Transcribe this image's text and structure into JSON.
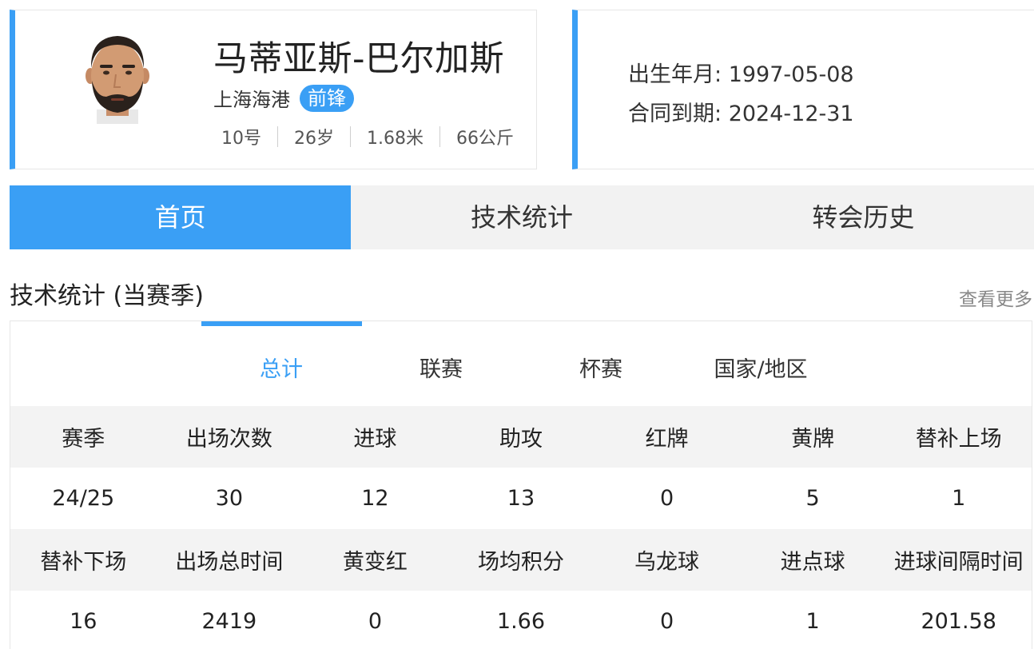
{
  "player": {
    "name": "马蒂亚斯-巴尔加斯",
    "team": "上海海港",
    "position": "前锋",
    "info": [
      "10号",
      "26岁",
      "1.68米",
      "66公斤"
    ],
    "birth_label": "出生年月:",
    "birth_value": "1997-05-08",
    "contract_label": "合同到期:",
    "contract_value": "2024-12-31"
  },
  "colors": {
    "accent": "#3a9ff5",
    "row_gray": "#f3f3f3"
  },
  "tabs": [
    {
      "label": "首页",
      "active": true
    },
    {
      "label": "技术统计",
      "active": false
    },
    {
      "label": "转会历史",
      "active": false
    }
  ],
  "stats": {
    "title": "技术统计 (当赛季)",
    "more": "查看更多",
    "subtabs": [
      {
        "label": "总计",
        "active": true
      },
      {
        "label": "联赛",
        "active": false
      },
      {
        "label": "杯赛",
        "active": false
      },
      {
        "label": "国家/地区",
        "active": false
      }
    ],
    "rows": [
      [
        "赛季",
        "出场次数",
        "进球",
        "助攻",
        "红牌",
        "黄牌",
        "替补上场"
      ],
      [
        "24/25",
        "30",
        "12",
        "13",
        "0",
        "5",
        "1"
      ],
      [
        "替补下场",
        "出场总时间",
        "黄变红",
        "场均积分",
        "乌龙球",
        "进点球",
        "进球间隔时间"
      ],
      [
        "16",
        "2419",
        "0",
        "1.66",
        "0",
        "1",
        "201.58"
      ]
    ]
  }
}
